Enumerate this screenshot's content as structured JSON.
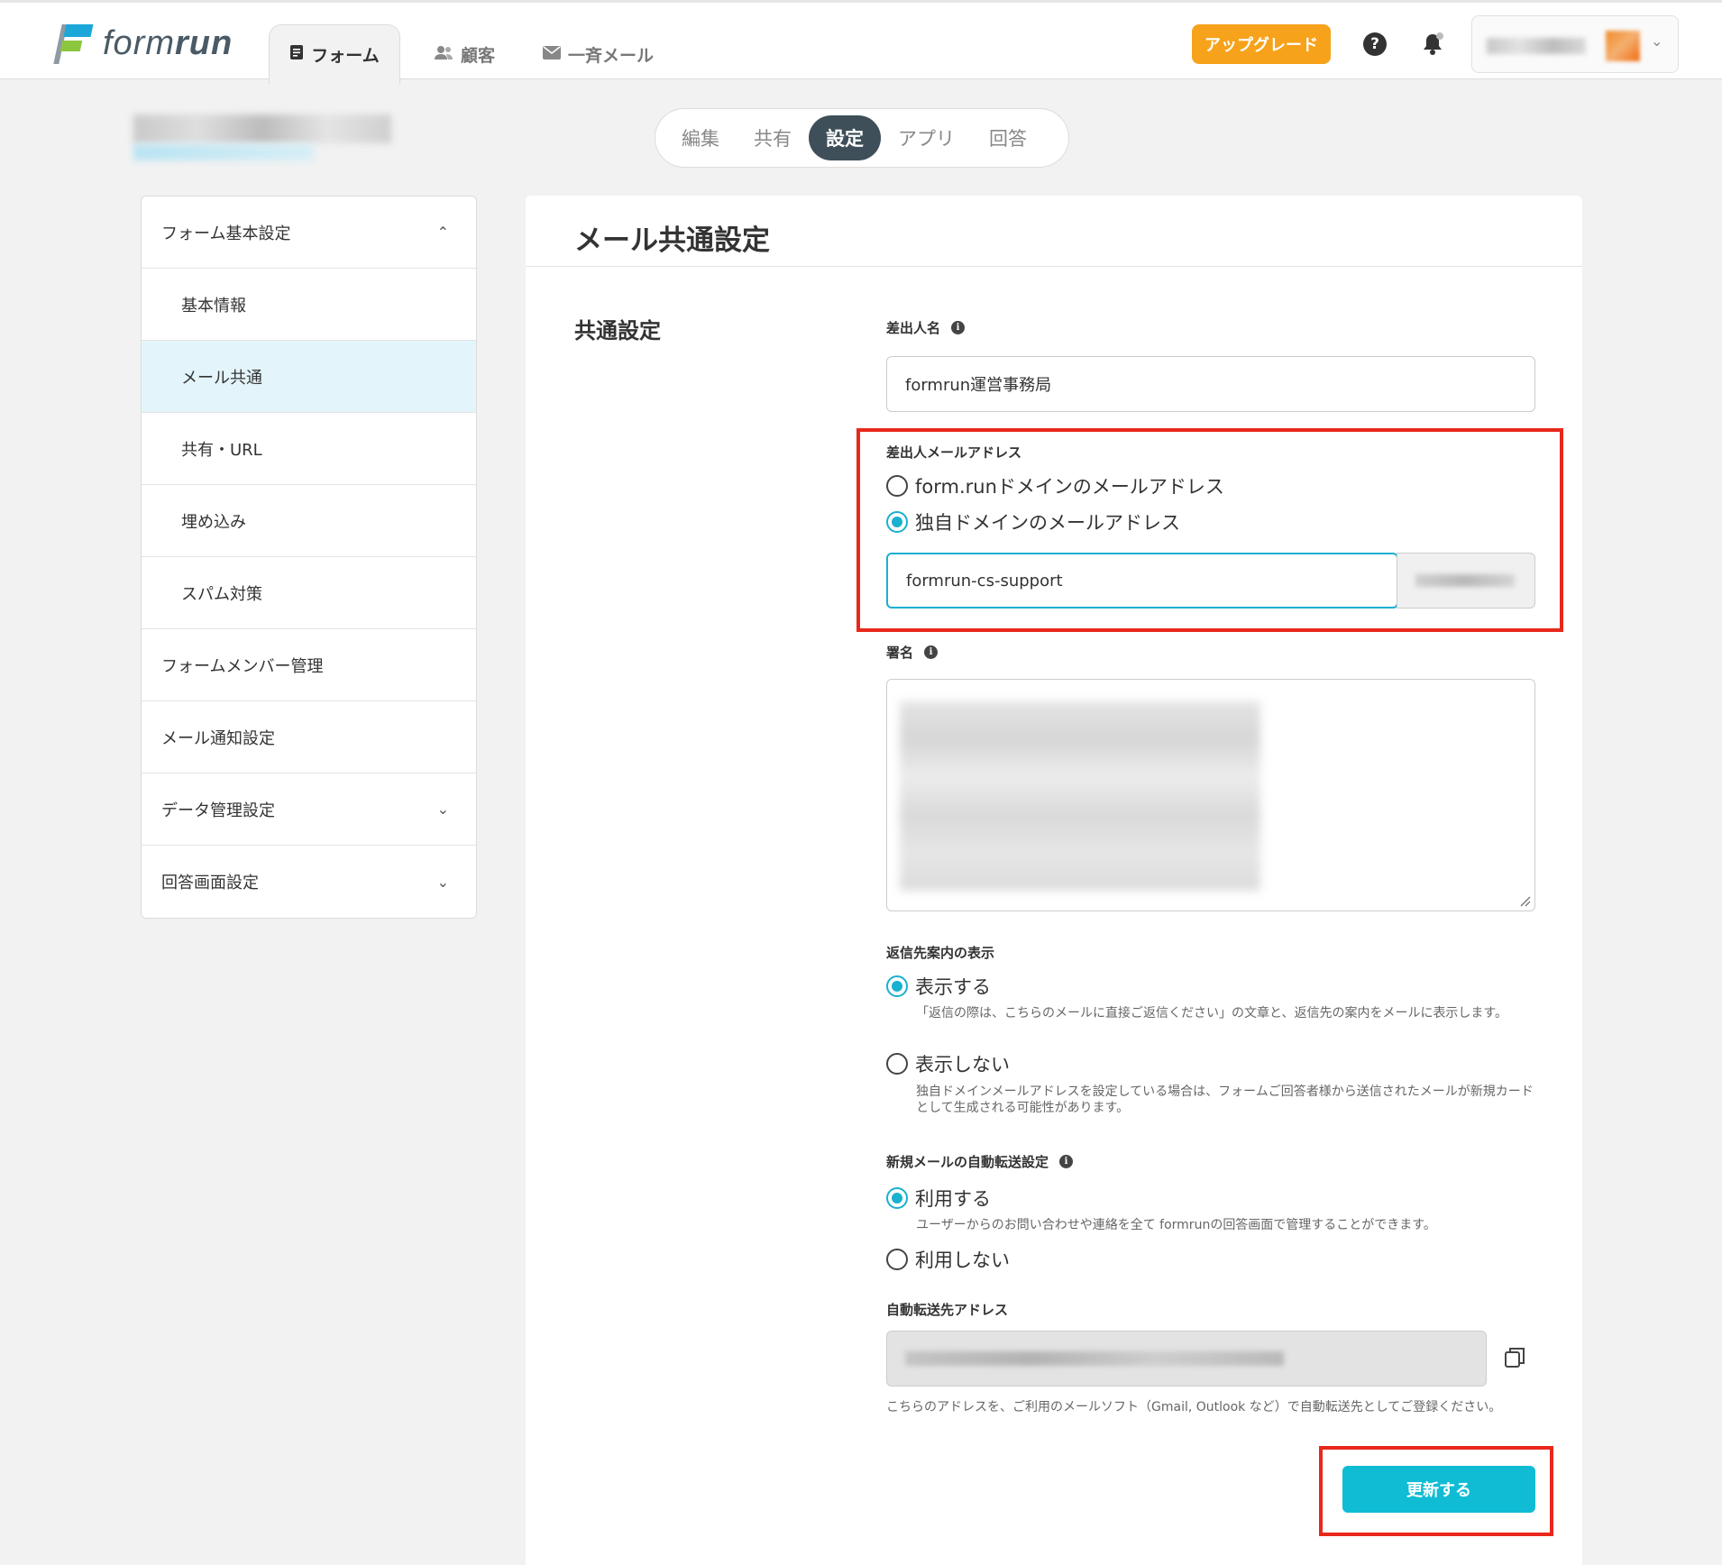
{
  "header": {
    "logo_text_light": "form",
    "logo_text_bold": "run",
    "nav": [
      {
        "label": "フォーム",
        "icon": "document-icon",
        "active": true
      },
      {
        "label": "顧客",
        "icon": "people-icon",
        "active": false
      },
      {
        "label": "一斉メール",
        "icon": "mail-icon",
        "active": false
      }
    ],
    "upgrade_label": "アップグレード",
    "help_glyph": "?"
  },
  "tabs": [
    "編集",
    "共有",
    "設定",
    "アプリ",
    "回答"
  ],
  "active_tab": "設定",
  "sidebar": {
    "items": [
      {
        "label": "フォーム基本設定",
        "chevron": "⌃"
      },
      {
        "label": "基本情報"
      },
      {
        "label": "メール共通"
      },
      {
        "label": "共有・URL"
      },
      {
        "label": "埋め込み"
      },
      {
        "label": "スパム対策"
      },
      {
        "label": "フォームメンバー管理"
      },
      {
        "label": "メール通知設定"
      },
      {
        "label": "データ管理設定",
        "chevron": "⌄"
      },
      {
        "label": "回答画面設定",
        "chevron": "⌄"
      }
    ]
  },
  "main": {
    "title": "メール共通設定",
    "section_title": "共通設定",
    "sender_name": {
      "label": "差出人名",
      "value": "formrun運営事務局"
    },
    "sender_email": {
      "label": "差出人メールアドレス",
      "options": [
        "form.runドメインのメールアドレス",
        "独自ドメインのメールアドレス"
      ],
      "selected": "独自ドメインのメールアドレス",
      "local_part": "formrun-cs-support"
    },
    "signature": {
      "label": "署名"
    },
    "reply_guide": {
      "label": "返信先案内の表示",
      "options": [
        {
          "label": "表示する",
          "help": "「返信の際は、こちらのメールに直接ご返信ください」の文章と、返信先の案内をメールに表示します。"
        },
        {
          "label": "表示しない",
          "help": "独自ドメインメールアドレスを設定している場合は、フォームご回答者様から送信されたメールが新規カードとして生成される可能性があります。"
        }
      ],
      "selected": "表示する"
    },
    "auto_forward": {
      "label": "新規メールの自動転送設定",
      "options": [
        {
          "label": "利用する",
          "help": "ユーザーからのお問い合わせや連絡を全て formrunの回答画面で管理することができます。"
        },
        {
          "label": "利用しない",
          "help": ""
        }
      ],
      "selected": "利用する"
    },
    "forward_address": {
      "label": "自動転送先アドレス",
      "help": "こちらのアドレスを、ご利用のメールソフト（Gmail, Outlook など）で自動転送先としてご登録ください。"
    },
    "submit_label": "更新する"
  },
  "colors": {
    "accent": "#10bcd4",
    "upgrade": "#f7a21b",
    "highlight": "#e8281b",
    "active_tab": "#3e4f59"
  }
}
